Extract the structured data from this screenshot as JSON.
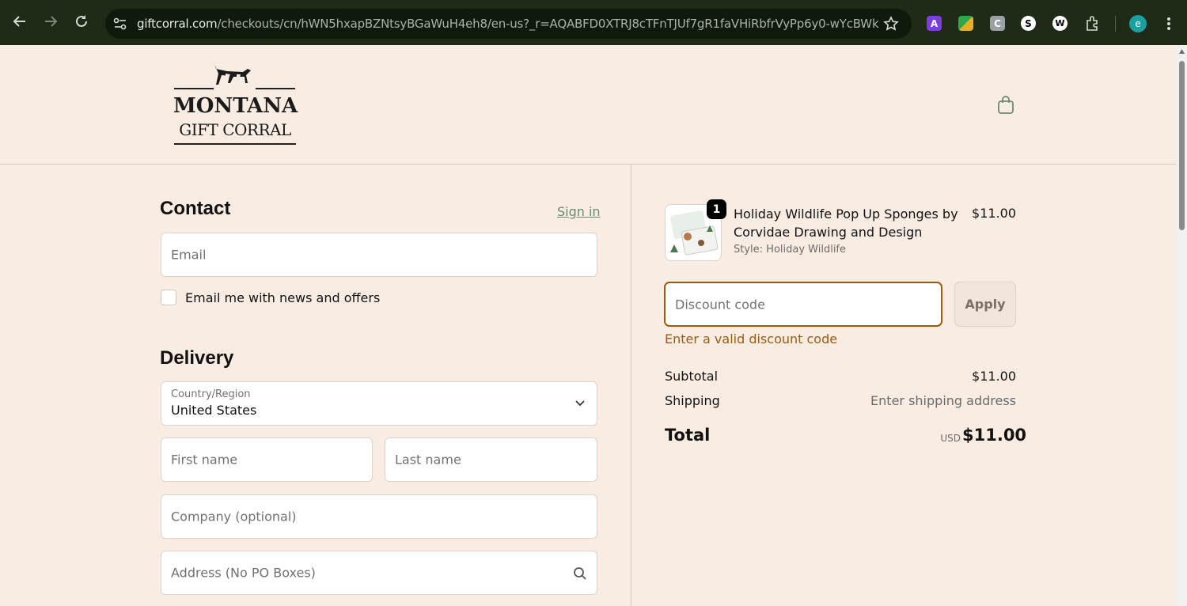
{
  "browser": {
    "url_host": "giftcorral.com",
    "url_path": "/checkouts/cn/hWN5hxapBZNtsyBGaWuH4eh8/en-us?_r=AQABFD0XTRJ8cTFnTJUf7gR1faVHiRbfrVyPp6y0-wYcBWk",
    "profile_initial": "e",
    "icons": [
      "back-icon",
      "forward-icon",
      "reload-icon",
      "site-info-icon",
      "bookmark-star-icon",
      "extensions-icon",
      "menu-icon"
    ]
  },
  "brand": {
    "line1": "MONTANA",
    "line2": "GIFT CORRAL"
  },
  "contact": {
    "heading": "Contact",
    "sign_in": "Sign in",
    "email_placeholder": "Email",
    "newsletter_label": "Email me with news and offers"
  },
  "delivery": {
    "heading": "Delivery",
    "country_label": "Country/Region",
    "country_value": "United States",
    "first_name_placeholder": "First name",
    "last_name_placeholder": "Last name",
    "company_placeholder": "Company (optional)",
    "address_placeholder": "Address (No PO Boxes)"
  },
  "summary": {
    "item": {
      "quantity": "1",
      "title": "Holiday Wildlife Pop Up Sponges by Corvidae Drawing and Design",
      "style": "Style: Holiday Wildlife",
      "price": "$11.00"
    },
    "discount_placeholder": "Discount code",
    "apply_label": "Apply",
    "error": "Enter a valid discount code",
    "subtotal_label": "Subtotal",
    "subtotal_value": "$11.00",
    "shipping_label": "Shipping",
    "shipping_value": "Enter shipping address",
    "total_label": "Total",
    "total_currency": "USD",
    "total_value": "$11.00"
  },
  "colors": {
    "page_bg": "#f9ece3",
    "accent_link": "#6a8a74",
    "error": "#9a5b10",
    "chrome_bg": "#1f2a17"
  }
}
